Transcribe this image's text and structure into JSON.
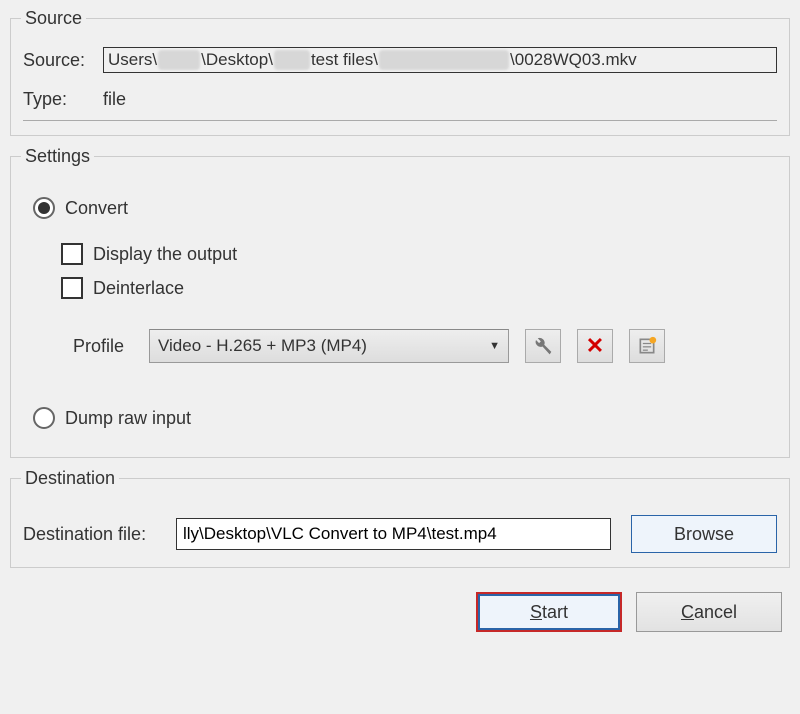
{
  "source": {
    "legend": "Source",
    "source_label": "Source:",
    "path_parts": {
      "p1": "Users\\",
      "p2": "\\Desktop\\",
      "p3": "test files\\",
      "p4": "\\0028WQ03.mkv"
    },
    "type_label": "Type:",
    "type_value": "file"
  },
  "settings": {
    "legend": "Settings",
    "convert_label": "Convert",
    "display_output_label": "Display the output",
    "deinterlace_label": "Deinterlace",
    "profile_label": "Profile",
    "profile_selected": "Video - H.265 + MP3 (MP4)",
    "dump_label": "Dump raw input",
    "convert_selected": true,
    "dump_selected": false,
    "display_output_checked": false,
    "deinterlace_checked": false
  },
  "destination": {
    "legend": "Destination",
    "label": "Destination file:",
    "value": "lly\\Desktop\\VLC Convert to MP4\\test.mp4",
    "browse_label": "Browse"
  },
  "buttons": {
    "start": "Start",
    "cancel": "Cancel"
  }
}
